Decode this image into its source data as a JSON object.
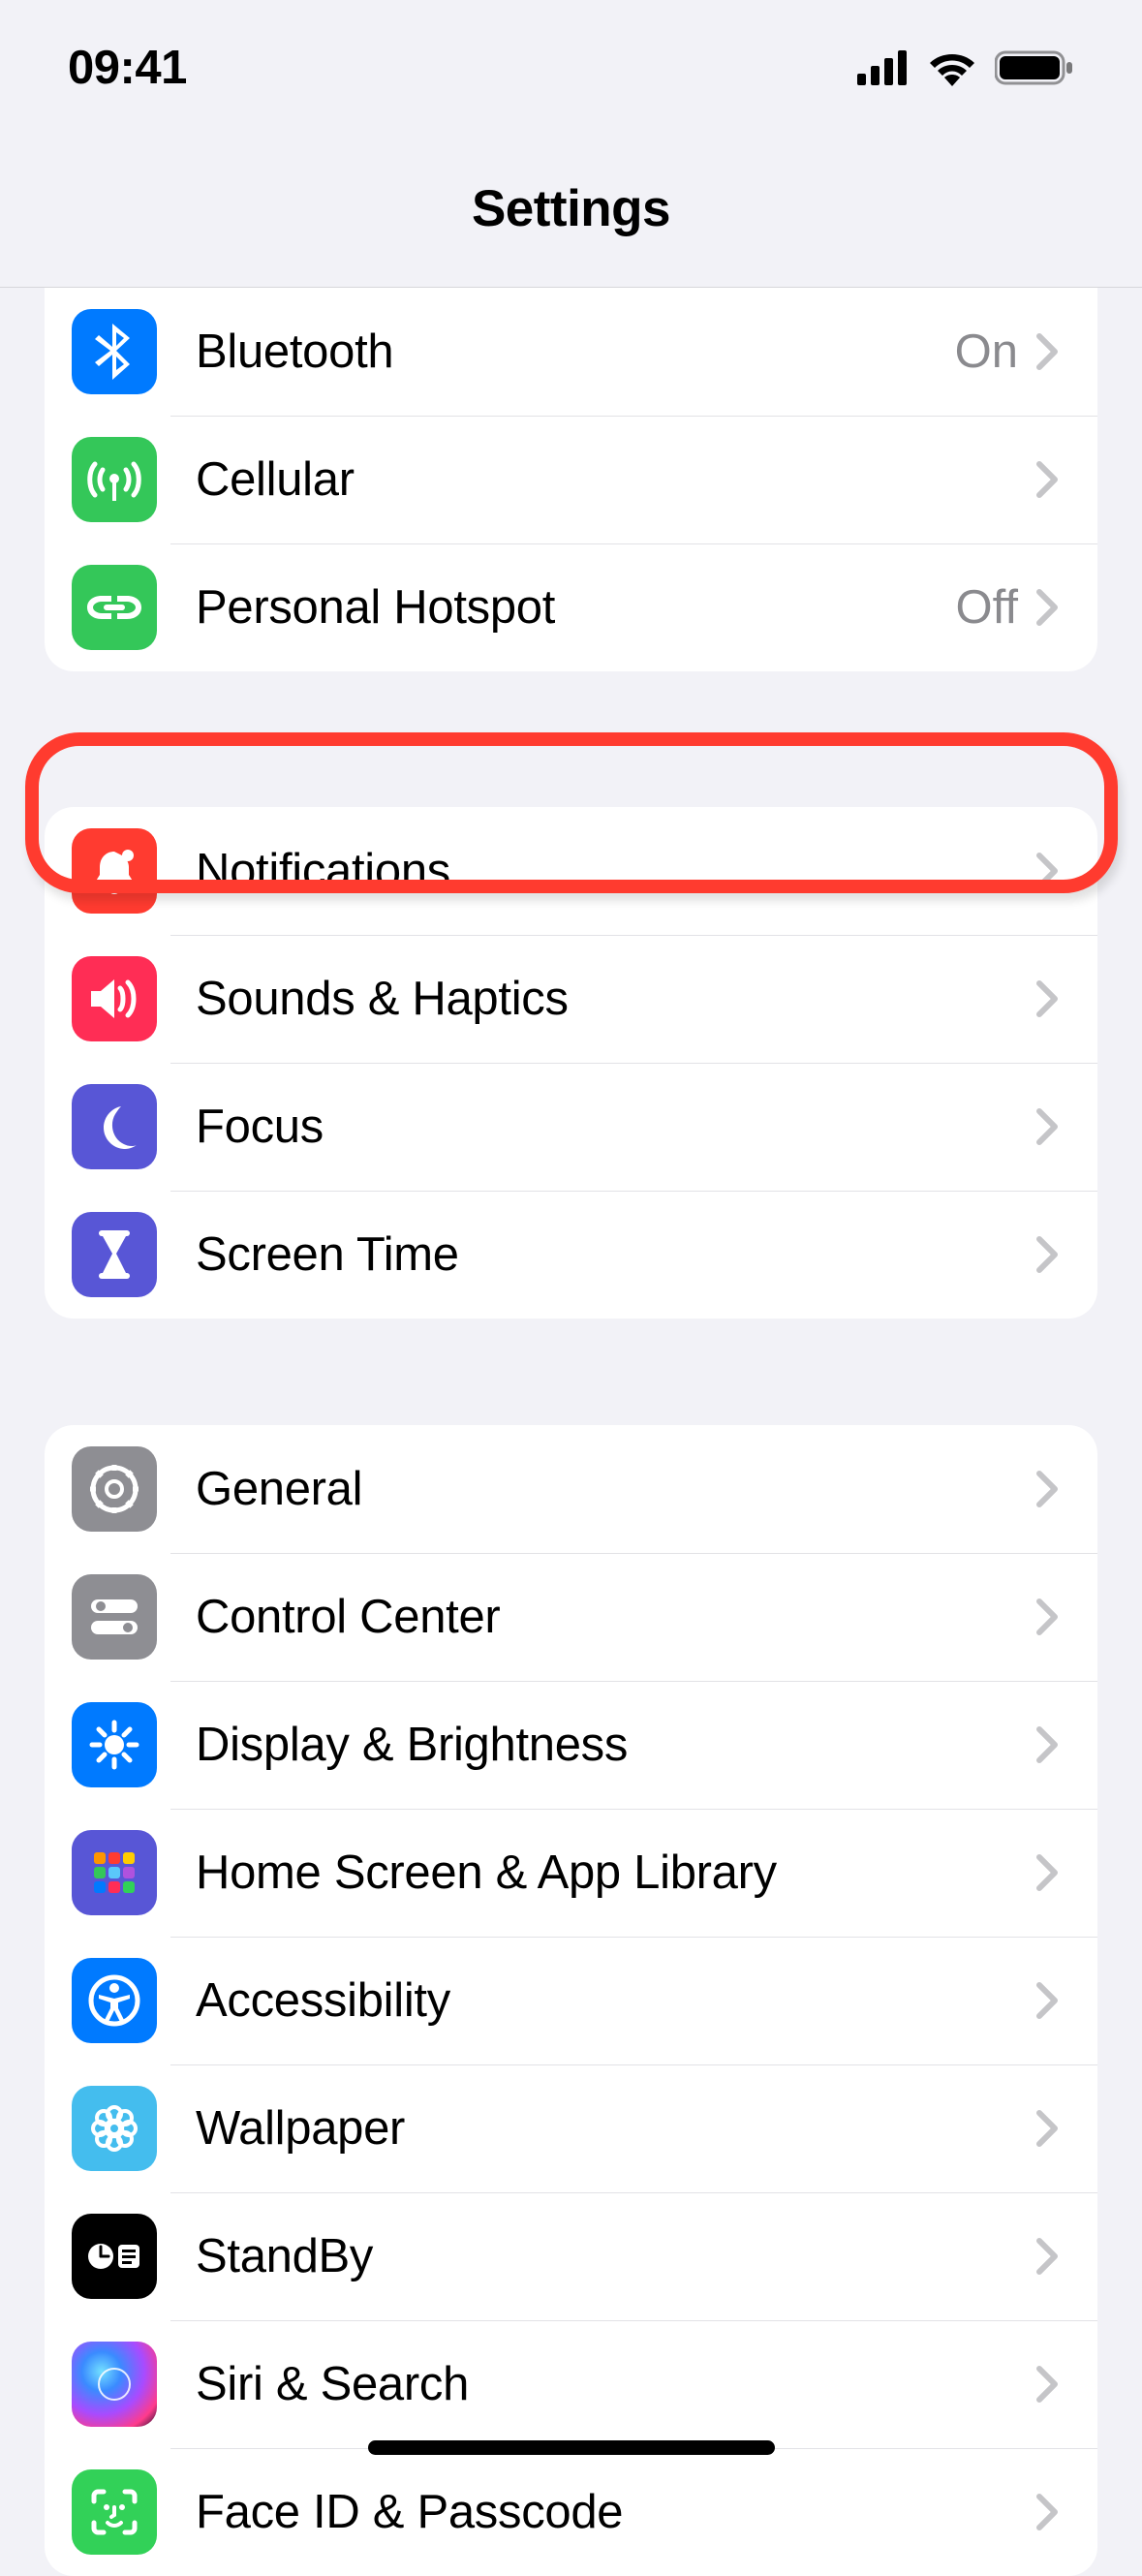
{
  "status": {
    "time": "09:41"
  },
  "header": {
    "title": "Settings"
  },
  "groups": [
    {
      "rows": [
        {
          "label": "Bluetooth",
          "value": "On"
        },
        {
          "label": "Cellular",
          "value": ""
        },
        {
          "label": "Personal Hotspot",
          "value": "Off"
        }
      ]
    },
    {
      "rows": [
        {
          "label": "Notifications",
          "value": ""
        },
        {
          "label": "Sounds & Haptics",
          "value": ""
        },
        {
          "label": "Focus",
          "value": ""
        },
        {
          "label": "Screen Time",
          "value": ""
        }
      ]
    },
    {
      "rows": [
        {
          "label": "General",
          "value": ""
        },
        {
          "label": "Control Center",
          "value": ""
        },
        {
          "label": "Display & Brightness",
          "value": ""
        },
        {
          "label": "Home Screen & App Library",
          "value": ""
        },
        {
          "label": "Accessibility",
          "value": ""
        },
        {
          "label": "Wallpaper",
          "value": ""
        },
        {
          "label": "StandBy",
          "value": ""
        },
        {
          "label": "Siri & Search",
          "value": ""
        },
        {
          "label": "Face ID & Passcode",
          "value": ""
        }
      ]
    }
  ],
  "highlight": {
    "group": 1,
    "row": 0
  }
}
